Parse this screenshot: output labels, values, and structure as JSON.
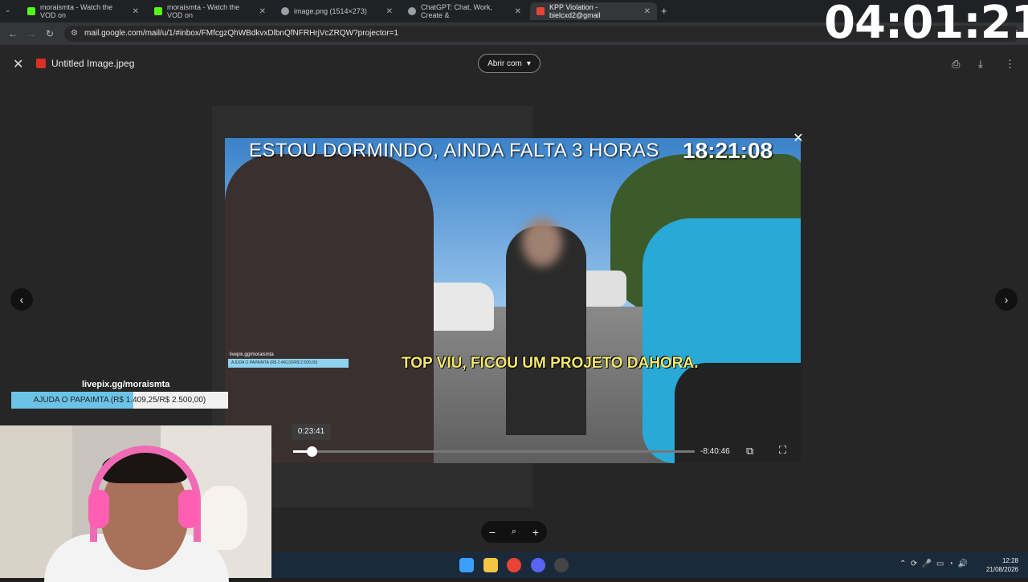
{
  "browser": {
    "tabs": [
      {
        "title": "moraismta - Watch the VOD on",
        "color": "#53fc18"
      },
      {
        "title": "moraismta - Watch the VOD on",
        "color": "#53fc18"
      },
      {
        "title": "image.png (1514×273)",
        "color": "#cccccc"
      },
      {
        "title": "ChatGPT: Chat, Work, Create &",
        "color": "#cccccc"
      },
      {
        "title": "KPP Violation - bielcxd2@gmail",
        "color": "#ea4335"
      }
    ],
    "url": "mail.google.com/mail/u/1/#inbox/FMfcgzQhWBdkvxDlbnQfNFRHrjVcZRQW?projector=1"
  },
  "viewer": {
    "title": "Untitled Image.jpeg",
    "open_with": "Abrir com"
  },
  "video": {
    "top_text": "ESTOU DORMINDO, AINDA FALTA 3 HORAS",
    "clock": "18:21:08",
    "subtitle": "TOP VIU, FICOU UM PROJETO DAHORA.",
    "livepix_small": "livepix.gg/moraismta",
    "livepix_small_bar": "AJUDA O PAPAIMTA (R$ 2.460,00/R$ 2.500,00)",
    "seek_time": "0:23:41",
    "remaining": "-8:40:46",
    "progress": 0.045
  },
  "overlay": {
    "stream_clock": "04:01:21",
    "livepix_label": "livepix.gg/moraismta",
    "livepix_text": "AJUDA O PAPAIMTA (R$ 1.409,25/R$ 2.500,00)",
    "livepix_progress": 0.5637
  },
  "taskbar": {
    "time": "12:28",
    "date": "21/08/2026"
  }
}
